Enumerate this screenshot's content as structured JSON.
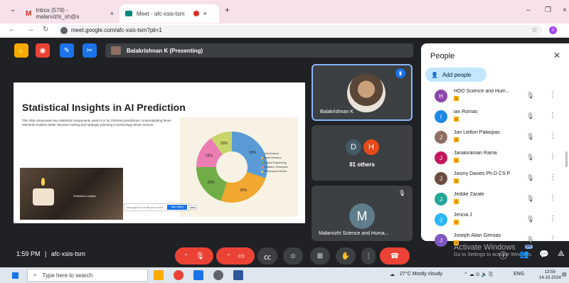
{
  "browser": {
    "tabs": [
      {
        "title": "Inbox (578) - malarvizhi_sh@s",
        "close": "×"
      },
      {
        "title": "Meet - afc-xsis-tsm",
        "close": "×"
      }
    ],
    "new_tab": "+",
    "window_controls": {
      "minimize": "–",
      "restore": "❐",
      "close": "×"
    },
    "url": "meet.google.com/afc-xsis-tsm?pli=1",
    "profile_initial": "A"
  },
  "meeting": {
    "presenter_label": "Balakrishnan K (Presenting)",
    "time": "1:59 PM",
    "separator": "|",
    "code": "afc-xsis-tsm",
    "tiles": {
      "main_speaker": "Balakrishnan K",
      "others_initials": [
        "D",
        "H"
      ],
      "others_label": "81 others",
      "third_initial": "M",
      "third_name": "Malarvizhi Science and Huma..."
    }
  },
  "slide": {
    "title": "Statistical Insights in AI Prediction",
    "body": "This slide showcases key statistical components used in AI for informed predictions. Understanding these elements enables better decision-making and strategic planning in technology-driven sectors.",
    "photo_caption": "Statistical Insights",
    "chat_placeholder": "Ask google ai to modify your content",
    "chat_button": "Start editing",
    "chat_button2": "Undo"
  },
  "chart_data": {
    "type": "pie",
    "categories": [
      "Data Analysis",
      "Model Selection",
      "Feature Engineering",
      "Validation Techniques",
      "Performance Metrics"
    ],
    "values": [
      30,
      25,
      20,
      15,
      10
    ],
    "labels": [
      "30%",
      "25%",
      "20%",
      "15%",
      "10%"
    ],
    "colors": [
      "#5b9bd5",
      "#f0a830",
      "#70ad47",
      "#ec7db2",
      "#c8d56a"
    ],
    "legend_position": "right"
  },
  "people_panel": {
    "title": "People",
    "add_people": "Add people",
    "participants": [
      {
        "name": "HOD Science and Hum...",
        "initial": "H",
        "color": "#8e44ad",
        "badge": "S"
      },
      {
        "name": "ian Romas",
        "initial": "I",
        "color": "#1e88e5",
        "badge": "S"
      },
      {
        "name": "Jan Leilton Palaspas",
        "initial": "J",
        "color": "#8d6e63",
        "badge": "S"
      },
      {
        "name": "Janakiraman Rama",
        "initial": "J",
        "color": "#c2185b",
        "badge": "S"
      },
      {
        "name": "Jasmy Davies Ph.D CS P",
        "initial": "J",
        "color": "#6d4c41",
        "badge": "S"
      },
      {
        "name": "Jeddie Zarate",
        "initial": "J",
        "color": "#26a69a",
        "badge": "S"
      },
      {
        "name": "Jencia J",
        "initial": "J",
        "color": "#29b6f6",
        "badge": "S"
      },
      {
        "name": "Joseph Allan Gemiao",
        "initial": "J",
        "color": "#7e57c2",
        "badge": "S"
      }
    ]
  },
  "watermark": {
    "line1": "Activate Windows",
    "line2": "Go to Settings to activate Windows.",
    "badge": "84"
  },
  "taskbar": {
    "search_placeholder": "Type here to search",
    "weather": "27°C  Mostly cloudy",
    "lang": "ENG",
    "time": "13:59",
    "date": "14-10-2024"
  }
}
